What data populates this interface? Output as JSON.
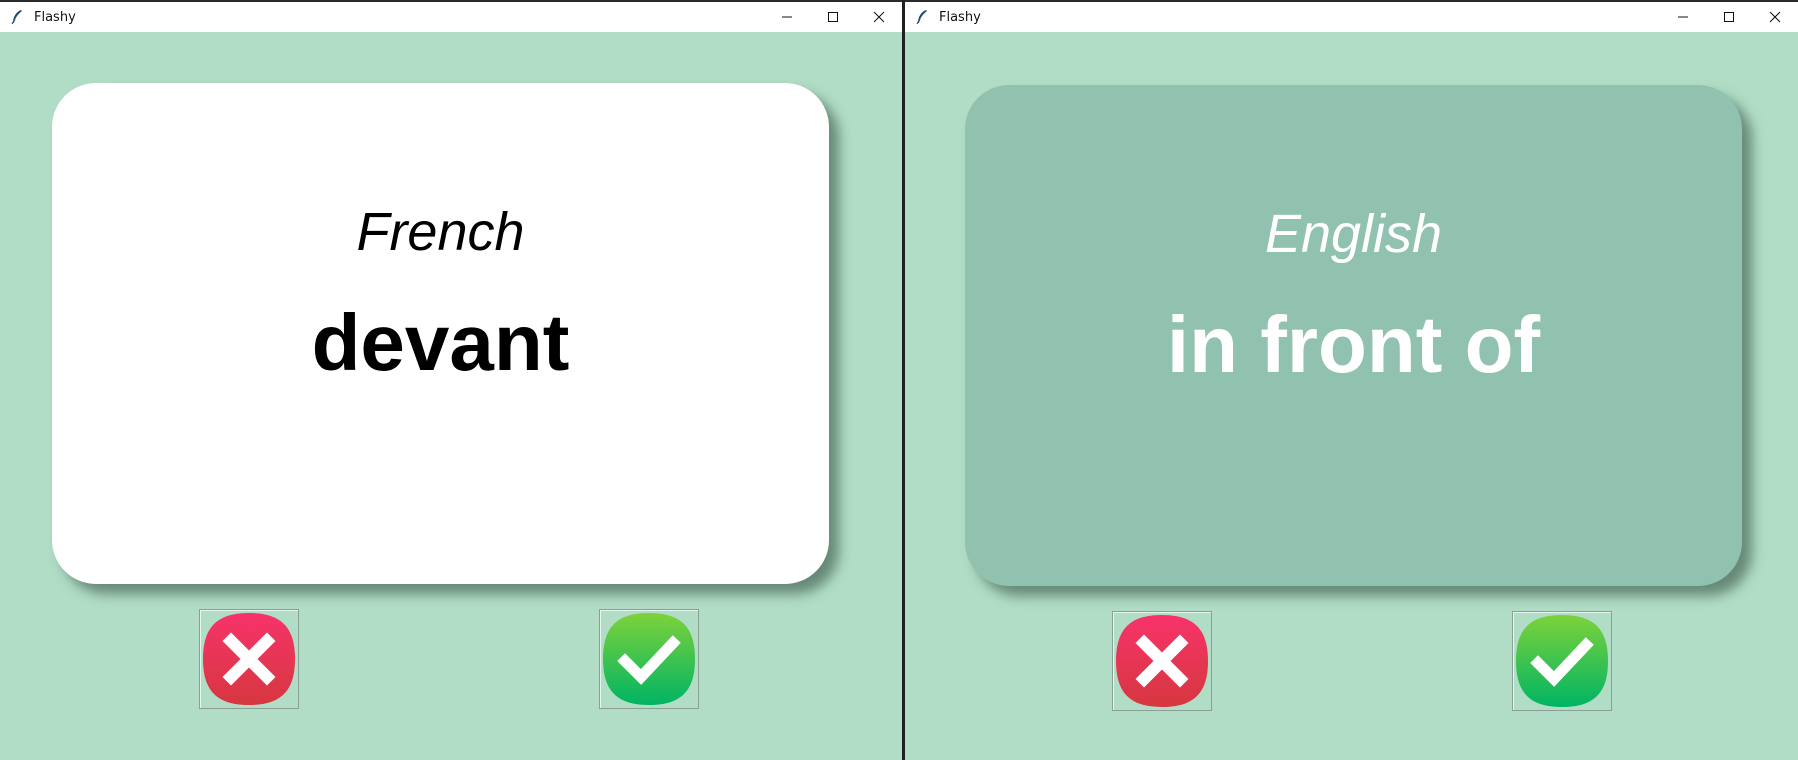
{
  "windows": [
    {
      "title": "Flashy",
      "card": {
        "language": "French",
        "word": "devant",
        "side": "front",
        "color": "#ffffff"
      },
      "buttons": {
        "wrong_icon": "x-icon",
        "right_icon": "checkmark-icon"
      }
    },
    {
      "title": "Flashy",
      "card": {
        "language": "English",
        "word": "in front of",
        "side": "back",
        "color": "#91c2af"
      },
      "buttons": {
        "wrong_icon": "x-icon",
        "right_icon": "checkmark-icon"
      }
    }
  ],
  "colors": {
    "background": "#b1ddc6",
    "wrong_button": "#e83d5a",
    "right_button": "#1ec566"
  }
}
